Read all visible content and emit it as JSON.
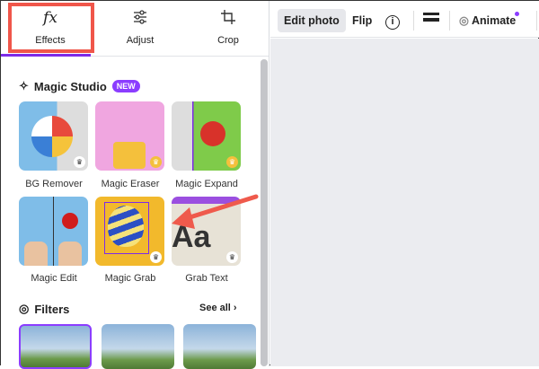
{
  "tabs": [
    {
      "label": "Effects",
      "icon": "fx-icon"
    },
    {
      "label": "Adjust",
      "icon": "sliders-icon"
    },
    {
      "label": "Crop",
      "icon": "crop-icon"
    }
  ],
  "magic_studio": {
    "title": "Magic Studio",
    "badge": "NEW",
    "tools": [
      {
        "label": "BG Remover"
      },
      {
        "label": "Magic Eraser"
      },
      {
        "label": "Magic Expand"
      },
      {
        "label": "Magic Edit"
      },
      {
        "label": "Magic Grab"
      },
      {
        "label": "Grab Text"
      }
    ]
  },
  "filters": {
    "title": "Filters",
    "see_all": "See all"
  },
  "toolbar": {
    "edit_photo": "Edit photo",
    "flip": "Flip",
    "animate": "Animate"
  },
  "colors": {
    "accent": "#8b3dff",
    "highlight": "#f0564a"
  }
}
